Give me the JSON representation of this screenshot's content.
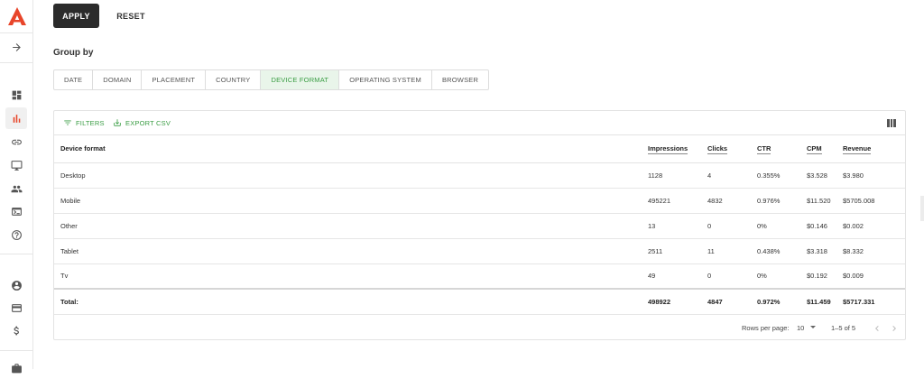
{
  "actions": {
    "apply_label": "APPLY",
    "reset_label": "RESET"
  },
  "group_by": {
    "label": "Group by",
    "tabs": [
      {
        "label": "DATE"
      },
      {
        "label": "DOMAIN"
      },
      {
        "label": "PLACEMENT"
      },
      {
        "label": "COUNTRY"
      },
      {
        "label": "DEVICE FORMAT",
        "active": true
      },
      {
        "label": "OPERATING SYSTEM"
      },
      {
        "label": "BROWSER"
      }
    ]
  },
  "toolbar": {
    "filters_label": "FILTERS",
    "export_label": "EXPORT CSV"
  },
  "table": {
    "headers": [
      "Device format",
      "Impressions",
      "Clicks",
      "CTR",
      "CPM",
      "Revenue"
    ],
    "rows": [
      [
        "Desktop",
        "1128",
        "4",
        "0.355%",
        "$3.528",
        "$3.980"
      ],
      [
        "Mobile",
        "495221",
        "4832",
        "0.976%",
        "$11.520",
        "$5705.008"
      ],
      [
        "Other",
        "13",
        "0",
        "0%",
        "$0.146",
        "$0.002"
      ],
      [
        "Tablet",
        "2511",
        "11",
        "0.438%",
        "$3.318",
        "$8.332"
      ],
      [
        "Tv",
        "49",
        "0",
        "0%",
        "$0.192",
        "$0.009"
      ]
    ],
    "total": [
      "Total:",
      "498922",
      "4847",
      "0.972%",
      "$11.459",
      "$5717.331"
    ]
  },
  "pagination": {
    "rows_per_page_label": "Rows per page:",
    "rows_per_page_value": "10",
    "range": "1–5 of 5"
  },
  "colors": {
    "brand": "#e8452a",
    "accent": "#3a9d44",
    "button_dark": "#2b2b2b"
  },
  "icons": [
    "logo-a-icon",
    "arrow-right-icon",
    "dashboard-icon",
    "bar-chart-icon",
    "link-icon",
    "monitor-icon",
    "people-icon",
    "terminal-icon",
    "help-icon",
    "account-icon",
    "card-icon",
    "dollar-icon",
    "settings-icon"
  ]
}
